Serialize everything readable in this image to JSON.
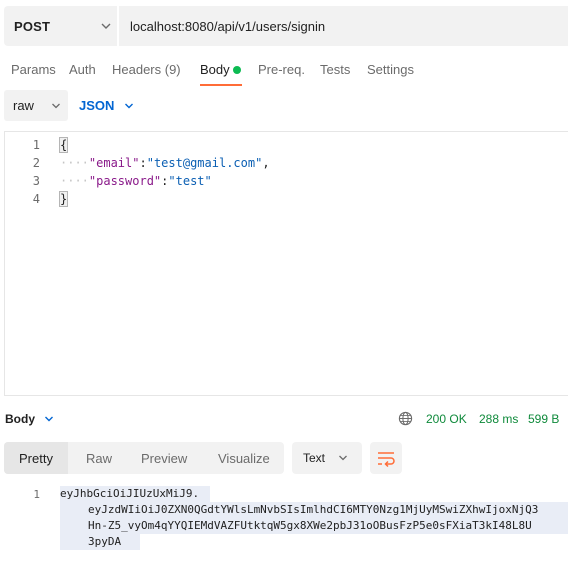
{
  "request": {
    "method": "POST",
    "url": "localhost:8080/api/v1/users/signin"
  },
  "tabs": [
    {
      "label": "Params"
    },
    {
      "label": "Auth"
    },
    {
      "label": "Headers (9)"
    },
    {
      "label": "Body"
    },
    {
      "label": "Pre-req."
    },
    {
      "label": "Tests"
    },
    {
      "label": "Settings"
    }
  ],
  "active_tab": "Body",
  "body_options": {
    "mode": "raw",
    "language": "JSON"
  },
  "editor": {
    "line_numbers": [
      "1",
      "2",
      "3",
      "4"
    ],
    "lines": [
      {
        "open_brace": "{"
      },
      {
        "dots": "····",
        "key": "\"email\"",
        "sep": ":",
        "value": "\"test@gmail.com\"",
        "trail": ","
      },
      {
        "dots": "····",
        "key": "\"password\"",
        "sep": ":",
        "value": "\"test\"",
        "trail": ""
      },
      {
        "close_brace": "}"
      }
    ]
  },
  "response": {
    "title": "Body",
    "status": "200 OK",
    "time": "288 ms",
    "size": "599 B",
    "view_tabs": [
      {
        "label": "Pretty"
      },
      {
        "label": "Raw"
      },
      {
        "label": "Preview"
      },
      {
        "label": "Visualize"
      }
    ],
    "active_view": "Pretty",
    "format": "Text",
    "line_number": "1",
    "body_lines": [
      "eyJhbGciOiJIUzUxMiJ9.",
      "eyJzdWIiOiJ0ZXN0QGdtYWlsLmNvbSIsImlhdCI6MTY0Nzg1MjUyMSwiZXhwIjoxNjQ3",
      "Hn-Z5_vyOm4qYYQIEMdVAZFUtktqW5gx8XWe2pbJ31oOBusFzP5e0sFXiaT3kI48L8U",
      "3pyDA"
    ]
  },
  "colors": {
    "accent_orange": "#ff6c37",
    "json_blue": "#0265d2",
    "status_green": "#0f8a3b",
    "body_dot_green": "#0cbb52"
  },
  "icons": {
    "method_dropdown": "chevron-down-icon",
    "network": "globe-icon",
    "wrap": "wrap-lines-icon"
  }
}
